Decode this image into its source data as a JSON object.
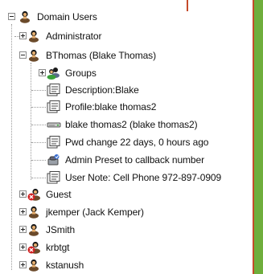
{
  "tree": {
    "root": {
      "label": "Domain Users",
      "icon": "user-group-icon",
      "expanded": true
    },
    "items": [
      {
        "label": "Administrator",
        "icon": "user-icon",
        "expanded": false
      },
      {
        "label": "BThomas (Blake Thomas)",
        "icon": "user-icon",
        "expanded": true,
        "children": [
          {
            "label": "Groups",
            "icon": "groups-icon",
            "expanded": false
          },
          {
            "label": "Description:Blake",
            "icon": "property-icon"
          },
          {
            "label": "Profile:blake thomas2",
            "icon": "property-icon"
          },
          {
            "label": "blake thomas2 (blake thomas2)",
            "icon": "drive-icon"
          },
          {
            "label": "Pwd change 22 days, 0 hours ago",
            "icon": "property-icon"
          },
          {
            "label": "Admin Preset to callback number",
            "icon": "callback-icon"
          },
          {
            "label": "User Note: Cell Phone 972-897-0909",
            "icon": "property-icon"
          }
        ]
      },
      {
        "label": "Guest",
        "icon": "disabled-user-icon",
        "expanded": false
      },
      {
        "label": "jkemper (Jack Kemper)",
        "icon": "user-icon",
        "expanded": false
      },
      {
        "label": "JSmith",
        "icon": "user-icon",
        "expanded": false
      },
      {
        "label": "krbtgt",
        "icon": "disabled-user-icon",
        "expanded": false
      },
      {
        "label": "kstanush",
        "icon": "user-icon",
        "expanded": false
      }
    ]
  },
  "colors": {
    "accent_border": "#c54a2a",
    "background_green": "#6fae3c"
  }
}
